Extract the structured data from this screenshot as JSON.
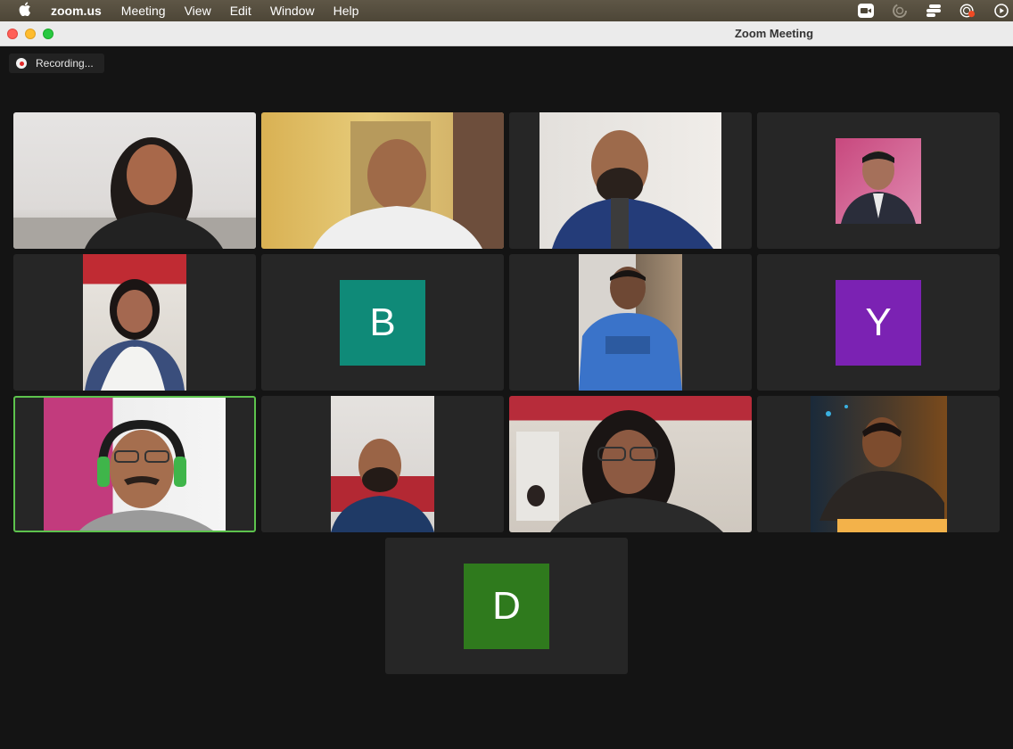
{
  "menubar": {
    "app_name": "zoom.us",
    "items": [
      "Meeting",
      "View",
      "Edit",
      "Window",
      "Help"
    ],
    "status_icons": [
      "zoom-video-icon",
      "activity-spinner-icon",
      "stage-manager-icon",
      "screen-record-icon",
      "play-icon"
    ]
  },
  "window": {
    "title": "Zoom Meeting"
  },
  "recording": {
    "label": "Recording...",
    "dot_color": "#e02828"
  },
  "active_speaker_color": "#5dc34d",
  "tiles": [
    {
      "kind": "video",
      "desc": "woman-smiling"
    },
    {
      "kind": "video",
      "desc": "man-yellow-room"
    },
    {
      "kind": "video",
      "desc": "man-blue-blazer"
    },
    {
      "kind": "photo",
      "desc": "man-profile-photo"
    },
    {
      "kind": "video",
      "desc": "woman-white-shawl"
    },
    {
      "kind": "avatar",
      "letter": "B",
      "color": "#0f8a78"
    },
    {
      "kind": "video",
      "desc": "man-blue-tshirt"
    },
    {
      "kind": "avatar",
      "letter": "Y",
      "color": "#7b22b3"
    },
    {
      "kind": "video",
      "desc": "man-headphones",
      "active": true
    },
    {
      "kind": "video",
      "desc": "man-car-seat"
    },
    {
      "kind": "video",
      "desc": "woman-curly-hair"
    },
    {
      "kind": "video",
      "desc": "man-warm-light"
    },
    {
      "kind": "avatar",
      "letter": "D",
      "color": "#2f7a1d"
    }
  ]
}
